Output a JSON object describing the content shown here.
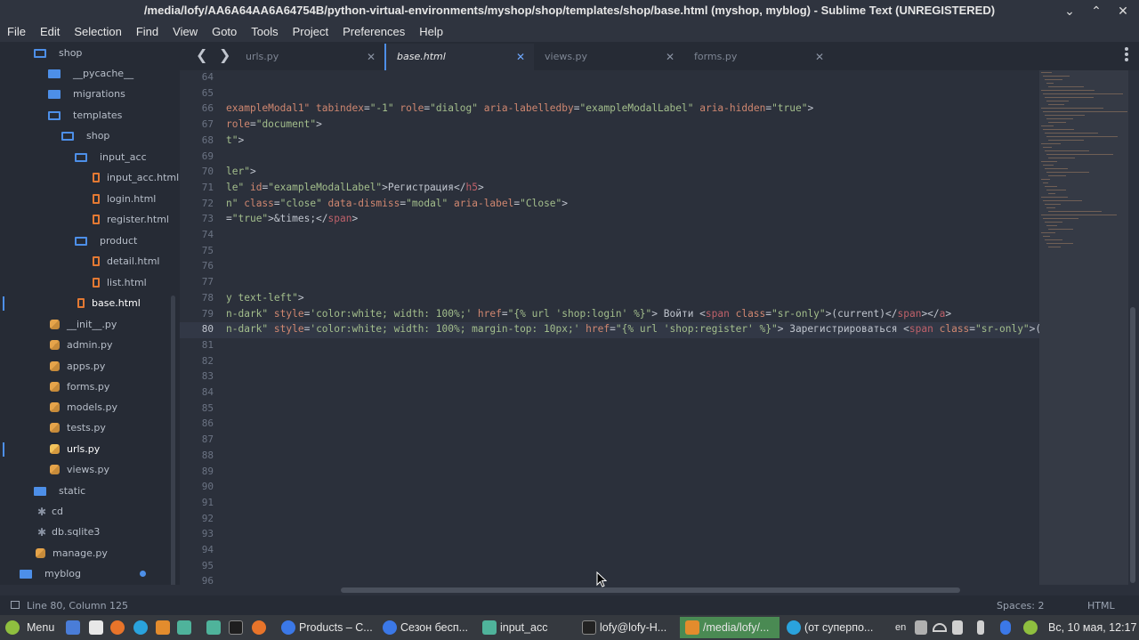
{
  "window": {
    "title": "/media/lofy/AA6A64AA6A64754B/python-virtual-environments/myshop/shop/templates/shop/base.html (myshop, myblog) - Sublime Text (UNREGISTERED)",
    "minimize": "⌄",
    "maximize": "⌃",
    "close": "✕"
  },
  "menu": [
    "File",
    "Edit",
    "Selection",
    "Find",
    "View",
    "Goto",
    "Tools",
    "Project",
    "Preferences",
    "Help"
  ],
  "sidebar": {
    "items": [
      {
        "label": "shop",
        "type": "folder-open"
      },
      {
        "label": "__pycache__",
        "type": "folder"
      },
      {
        "label": "migrations",
        "type": "folder"
      },
      {
        "label": "templates",
        "type": "folder-open"
      },
      {
        "label": "shop",
        "type": "folder-open"
      },
      {
        "label": "input_acc",
        "type": "folder-open"
      },
      {
        "label": "input_acc.html",
        "type": "html"
      },
      {
        "label": "login.html",
        "type": "html"
      },
      {
        "label": "register.html",
        "type": "html"
      },
      {
        "label": "product",
        "type": "folder-open"
      },
      {
        "label": "detail.html",
        "type": "html"
      },
      {
        "label": "list.html",
        "type": "html"
      },
      {
        "label": "base.html",
        "type": "html"
      },
      {
        "label": "__init__.py",
        "type": "py"
      },
      {
        "label": "admin.py",
        "type": "py"
      },
      {
        "label": "apps.py",
        "type": "py"
      },
      {
        "label": "forms.py",
        "type": "py"
      },
      {
        "label": "models.py",
        "type": "py"
      },
      {
        "label": "tests.py",
        "type": "py"
      },
      {
        "label": "urls.py",
        "type": "py"
      },
      {
        "label": "views.py",
        "type": "py"
      },
      {
        "label": "static",
        "type": "folder"
      },
      {
        "label": "cd",
        "type": "other"
      },
      {
        "label": "db.sqlite3",
        "type": "other"
      },
      {
        "label": "manage.py",
        "type": "py"
      },
      {
        "label": "myblog",
        "type": "folder"
      }
    ]
  },
  "tabs": [
    {
      "label": "urls.py",
      "close": "✕"
    },
    {
      "label": "base.html",
      "close": "✕"
    },
    {
      "label": "views.py",
      "close": "✕"
    },
    {
      "label": "forms.py",
      "close": "✕"
    }
  ],
  "nav": {
    "back": "❮",
    "forward": "❯"
  },
  "editor": {
    "line_numbers": [
      "64",
      "65",
      "66",
      "67",
      "68",
      "69",
      "70",
      "71",
      "72",
      "73",
      "74",
      "75",
      "76",
      "77",
      "78",
      "79",
      "80",
      "81",
      "82",
      "83",
      "84",
      "85",
      "86",
      "87",
      "88",
      "89",
      "90",
      "91",
      "92",
      "93",
      "94",
      "95",
      "96"
    ],
    "current_line": "80",
    "lines": {
      "66": [
        [
          "c-attr",
          "exampleModal1\" "
        ],
        [
          "c-attr",
          "tabindex"
        ],
        [
          "c-txt",
          "="
        ],
        [
          "c-str",
          "\"-1\" "
        ],
        [
          "c-attr",
          "role"
        ],
        [
          "c-txt",
          "="
        ],
        [
          "c-str",
          "\"dialog\" "
        ],
        [
          "c-attr",
          "aria-labelledby"
        ],
        [
          "c-txt",
          "="
        ],
        [
          "c-str",
          "\"exampleModalLabel\" "
        ],
        [
          "c-attr",
          "aria-hidden"
        ],
        [
          "c-txt",
          "="
        ],
        [
          "c-str",
          "\"true\""
        ],
        [
          "c-txt",
          ">"
        ]
      ],
      "67": [
        [
          "c-attr",
          "role"
        ],
        [
          "c-txt",
          "="
        ],
        [
          "c-str",
          "\"document\""
        ],
        [
          "c-txt",
          ">"
        ]
      ],
      "68": [
        [
          "c-str",
          "t\""
        ],
        [
          "c-txt",
          ">"
        ]
      ],
      "70": [
        [
          "c-str",
          "ler\""
        ],
        [
          "c-txt",
          ">"
        ]
      ],
      "71": [
        [
          "c-str",
          "le\" "
        ],
        [
          "c-attr",
          "id"
        ],
        [
          "c-txt",
          "="
        ],
        [
          "c-str",
          "\"exampleModalLabel\""
        ],
        [
          "c-txt",
          ">Регистрация</"
        ],
        [
          "c-tag",
          "h5"
        ],
        [
          "c-txt",
          ">"
        ]
      ],
      "72": [
        [
          "c-str",
          "n\" "
        ],
        [
          "c-attr",
          "class"
        ],
        [
          "c-txt",
          "="
        ],
        [
          "c-str",
          "\"close\" "
        ],
        [
          "c-attr",
          "data-dismiss"
        ],
        [
          "c-txt",
          "="
        ],
        [
          "c-str",
          "\"modal\" "
        ],
        [
          "c-attr",
          "aria-label"
        ],
        [
          "c-txt",
          "="
        ],
        [
          "c-str",
          "\"Close\""
        ],
        [
          "c-txt",
          ">"
        ]
      ],
      "73": [
        [
          "c-txt",
          "="
        ],
        [
          "c-str",
          "\"true\""
        ],
        [
          "c-txt",
          ">&times;</"
        ],
        [
          "c-tag",
          "span"
        ],
        [
          "c-txt",
          ">"
        ]
      ],
      "78": [
        [
          "c-str",
          "y text-left\""
        ],
        [
          "c-txt",
          ">"
        ]
      ],
      "79": [
        [
          "c-str",
          "n-dark\" "
        ],
        [
          "c-attr",
          "style"
        ],
        [
          "c-txt",
          "="
        ],
        [
          "c-str",
          "'color:white; width: 100%;' "
        ],
        [
          "c-attr",
          "href"
        ],
        [
          "c-txt",
          "="
        ],
        [
          "c-str",
          "\"{% url 'shop:login' %}\""
        ],
        [
          "c-txt",
          "> Войти <"
        ],
        [
          "c-tag",
          "span "
        ],
        [
          "c-attr",
          "class"
        ],
        [
          "c-txt",
          "="
        ],
        [
          "c-str",
          "\"sr-only\""
        ],
        [
          "c-txt",
          ">(current)</"
        ],
        [
          "c-tag",
          "span"
        ],
        [
          "c-txt",
          "></"
        ],
        [
          "c-tag",
          "a"
        ],
        [
          "c-txt",
          ">"
        ]
      ],
      "80": [
        [
          "c-str",
          "n-dark\" "
        ],
        [
          "c-attr",
          "style"
        ],
        [
          "c-txt",
          "="
        ],
        [
          "c-str",
          "'color:white; width: 100%; margin-top: 10px;' "
        ],
        [
          "c-attr",
          "href"
        ],
        [
          "c-txt",
          "="
        ],
        [
          "c-str",
          "\"{% url 'shop:register' %}\""
        ],
        [
          "c-txt",
          "> Зарегистрироваться <"
        ],
        [
          "c-tag",
          "span "
        ],
        [
          "c-attr",
          "class"
        ],
        [
          "c-txt",
          "="
        ],
        [
          "c-str",
          "\"sr-only\""
        ],
        [
          "c-txt",
          ">(curren"
        ]
      ]
    }
  },
  "status": {
    "position": "Line 80, Column 125",
    "indent": "Spaces: 2",
    "syntax": "HTML"
  },
  "taskbar": {
    "menu_label": "Menu",
    "windows": [
      {
        "label": "Products – C...",
        "color": "#3b78e7"
      },
      {
        "label": "Сезон бесп...",
        "color": "#3b78e7"
      },
      {
        "label": "input_acc",
        "color": "#4fb39b"
      },
      {
        "label": "lofy@lofy-H...",
        "color": "#222222"
      },
      {
        "label": "/media/lofy/...",
        "color": "#e38c2d"
      },
      {
        "label": "(от суперпо...",
        "color": "#2aa3dd"
      }
    ],
    "lang": "en",
    "clock": "Вс, 10 мая, 12:17"
  }
}
